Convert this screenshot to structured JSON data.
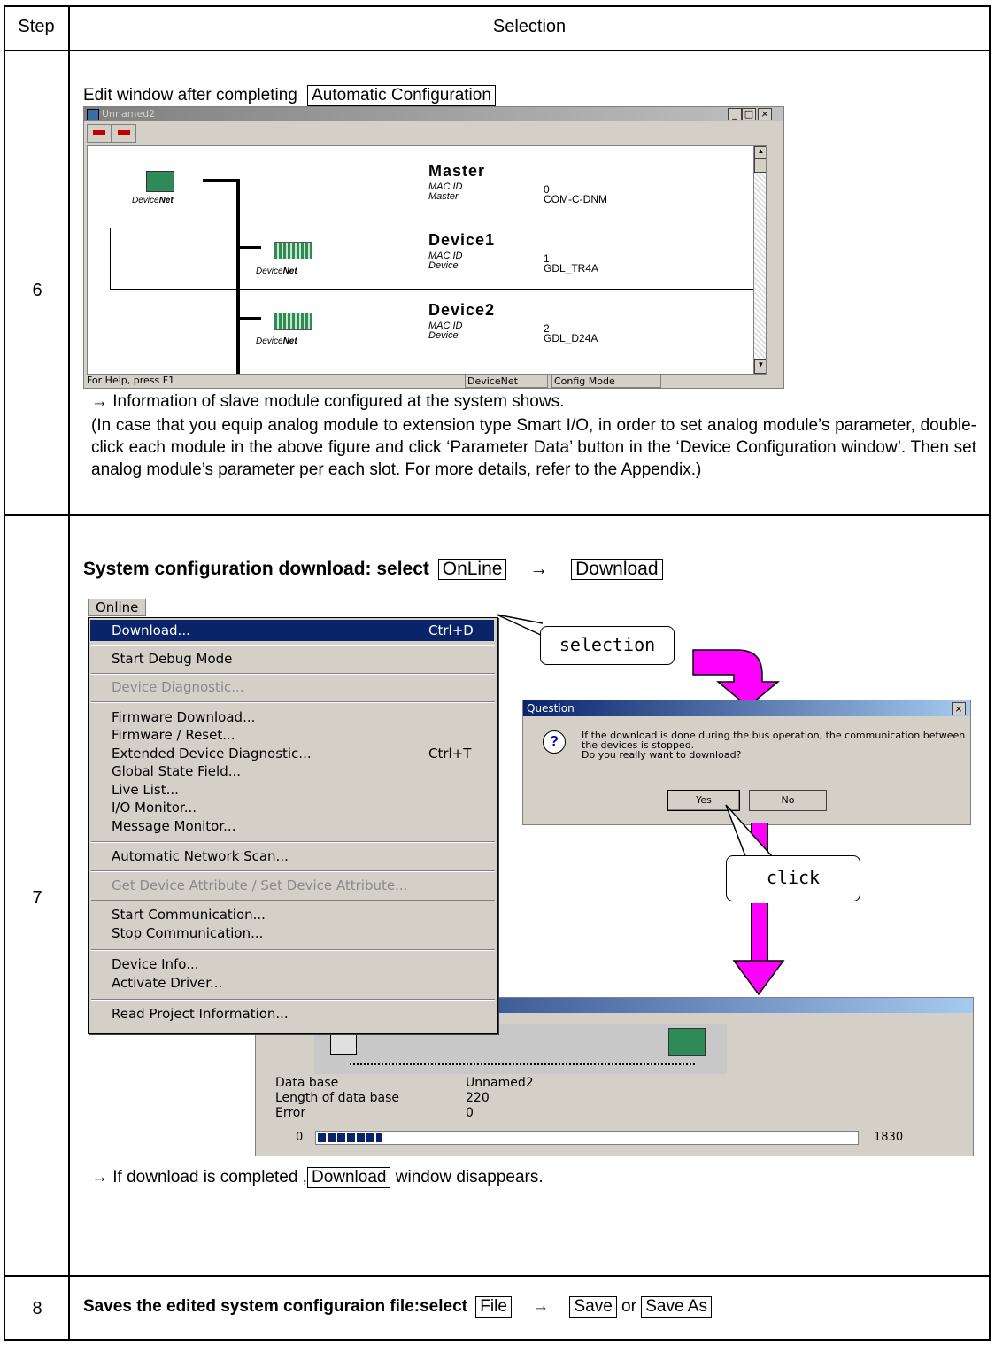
{
  "table": {
    "header_step": "Step",
    "header_selection": "Selection",
    "rows": [
      {
        "step": "6"
      },
      {
        "step": "7"
      },
      {
        "step": "8"
      }
    ]
  },
  "step6": {
    "intro": "Edit window after completing",
    "intro_box": "Automatic Configuration",
    "window": {
      "title": "Unnamed2",
      "status_help": "For Help, press F1",
      "status_net": "DeviceNet",
      "status_mode": "Config Mode",
      "logo_text_a": "Device",
      "logo_text_b": "Net",
      "nodes": [
        {
          "name": "Master",
          "label1": "MAC ID",
          "value1": "0",
          "label2": "Master",
          "value2": "COM-C-DNM"
        },
        {
          "name": "Device1",
          "label1": "MAC ID",
          "value1": "1",
          "label2": "Device",
          "value2": "GDL_TR4A"
        },
        {
          "name": "Device2",
          "label1": "MAC ID",
          "value1": "2",
          "label2": "Device",
          "value2": "GDL_D24A"
        }
      ]
    },
    "note1": "→ Information of slave module configured at the system shows.",
    "note2": "(In case that you equip analog module to extension type Smart I/O, in order to set analog module’s parameter, double-click each module in the above figure and click ‘Parameter Data’ button in the ‘Device Configuration window’. Then set analog module’s parameter per each slot. For more details, refer to the Appendix.)"
  },
  "step7": {
    "heading": "System configuration download: select",
    "box1": "OnLine",
    "arrow": "→",
    "box2": "Download",
    "menu_title": "Online",
    "menu_items": [
      {
        "label": "Download...",
        "shortcut": "Ctrl+D"
      },
      {
        "label": "Start Debug Mode",
        "shortcut": ""
      },
      {
        "label": "Device Diagnostic...",
        "shortcut": ""
      },
      {
        "label": "Firmware Download...",
        "shortcut": ""
      },
      {
        "label": "Firmware / Reset...",
        "shortcut": ""
      },
      {
        "label": "Extended Device Diagnostic...",
        "shortcut": "Ctrl+T"
      },
      {
        "label": "Global State Field...",
        "shortcut": ""
      },
      {
        "label": "Live List...",
        "shortcut": ""
      },
      {
        "label": "I/O Monitor...",
        "shortcut": ""
      },
      {
        "label": "Message Monitor...",
        "shortcut": ""
      },
      {
        "label": "Automatic Network Scan...",
        "shortcut": ""
      },
      {
        "label": "Get Device Attribute / Set Device Attribute...",
        "shortcut": ""
      },
      {
        "label": "Start Communication...",
        "shortcut": ""
      },
      {
        "label": "Stop Communication...",
        "shortcut": ""
      },
      {
        "label": "Device Info...",
        "shortcut": ""
      },
      {
        "label": "Activate Driver...",
        "shortcut": ""
      },
      {
        "label": "Read Project Information...",
        "shortcut": ""
      }
    ],
    "callout_selection": "selection",
    "callout_click": "click",
    "dialog": {
      "title": "Question",
      "close": "×",
      "message1": "If the download is done during the bus operation, the communication between",
      "message2": "the devices is stopped.",
      "message3": "Do you really want to download?",
      "yes": "Yes",
      "no": "No"
    },
    "download": {
      "label_db": "Data base",
      "value_db": "Unnamed2",
      "label_len": "Length of data base",
      "value_len": "220",
      "label_err": "Error",
      "value_err": "0",
      "progress_min": "0",
      "progress_max": "1830",
      "progress_fraction": 0.12
    },
    "after_pre": "→ If download is completed ,",
    "after_box": "Download",
    "after_post": "window disappears."
  },
  "step8": {
    "heading": "Saves the edited system configuraion file:select",
    "box1": "File",
    "arrow": "→",
    "box2": "Save",
    "or": "or",
    "box3": "Save As"
  },
  "colors": {
    "titlebar": "#0a246a",
    "arrow": "#ff00ff",
    "menu_highlight": "#0a246a"
  }
}
